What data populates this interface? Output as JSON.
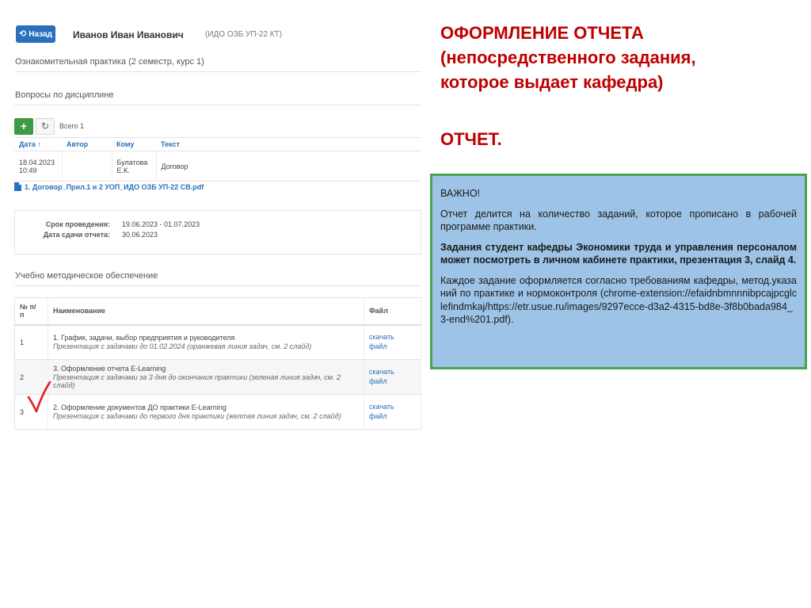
{
  "header": {
    "back_label": "Назад",
    "student_name": "Иванов Иван Иванович",
    "student_group": "(ИДО ОЗБ УП-22 КТ)"
  },
  "practice_title": "Ознакомительная практика (2 семестр, курс 1)",
  "questions": {
    "section_title": "Вопросы по дисциплине",
    "add_label": "+",
    "total_label": "Всего 1",
    "columns": [
      "Дата",
      "Автор",
      "Кому",
      "Текст"
    ],
    "rows": [
      {
        "date": "18.04.2023",
        "time": "10:49",
        "author": "",
        "to_line1": "Булатова",
        "to_line2": "Е.К.",
        "text": "Договор"
      }
    ],
    "attachment": "1. Договор_Прил.1 и 2 УОП_ИДО ОЗБ УП-22 СВ.pdf"
  },
  "period": {
    "term_label": "Срок проведения:",
    "term_value": "19.06.2023 - 01.07.2023",
    "due_label": "Дата сдачи отчета:",
    "due_value": "30.06.2023"
  },
  "materials": {
    "section_title": "Учебно методическое обеспечение",
    "col_num_line1": "№ п/",
    "col_num_line2": "п",
    "col_name": "Наименование",
    "col_file": "Файл",
    "rows": [
      {
        "num": "1",
        "title": "1. График, задачи, выбор предприятия и руководителя",
        "note": "Презентация с задачами до 01.02.2024 (оранжевая линия задач, см. 2 слайд)",
        "link1": "скачать",
        "link2": "файл"
      },
      {
        "num": "2",
        "title": "3. Оформление отчета E-Learning",
        "note": "Презентация с задачами за 3 дня до окончания практики (зеленая линия задач, см. 2 слайд)",
        "link1": "скачать",
        "link2": "файл"
      },
      {
        "num": "3",
        "title": "2. Оформление документов ДО практики E-Learning",
        "note": "Презентация с задачами до первого дня практики (желтая линия задач, см. 2 слайд)",
        "link1": "скачать",
        "link2": "файл"
      }
    ]
  },
  "slide": {
    "heading_line1": "ОФОРМЛЕНИЕ ОТЧЕТА",
    "heading_line2": "(непосредственного задания,",
    "heading_line3": "которое выдает кафедра)",
    "report_label": "ОТЧЕТ.",
    "info": {
      "important": "ВАЖНО!",
      "p1": "Отчет делится на количество заданий, которое прописано в рабочей программе практики.",
      "p2": "Задания студент кафедры Экономики труда и управления персоналом может посмотреть в личном кабинете практики, презентация 3, слайд 4.",
      "p3": "Каждое задание оформляется согласно требованиям кафедры, метод.указаний по практике и нормоконтроля (chrome-extension://efaidnbmnnnibpcajpcglclefindmkaj/https://etr.usue.ru/images/9297ecce-d3a2-4315-bd8e-3f8b0bada984_3-end%201.pdf)."
    }
  },
  "colors": {
    "heading_red": "#c00000",
    "info_bg": "#9dc3e6",
    "info_border": "#4aa34f",
    "link_blue": "#2a6fbe",
    "add_green": "#3e9a44",
    "check_red": "#e02020"
  },
  "icons": [
    "refresh-icon",
    "back-arrow-icon",
    "pdf-file-icon",
    "sort-up-icon",
    "checkmark-icon"
  ]
}
